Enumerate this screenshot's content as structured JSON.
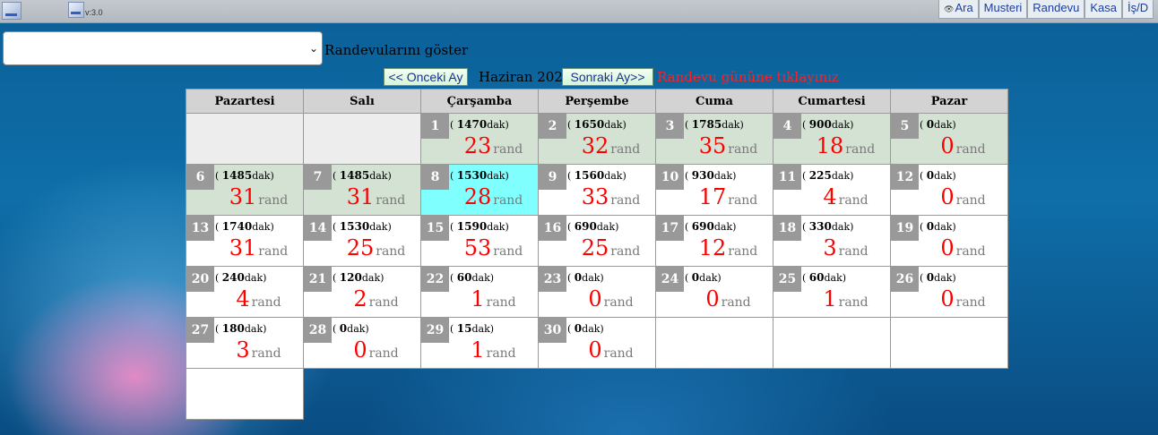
{
  "app": {
    "version": "v:3.0",
    "nav": [
      "Ara",
      "Musteri",
      "Randevu",
      "Kasa",
      "İş/D"
    ]
  },
  "filter": {
    "select_value": "",
    "label": "Randevularını göster"
  },
  "month_nav": {
    "prev_label": "<< Onceki Ay",
    "title": "Haziran 2022",
    "next_label": "Sonraki Ay>>",
    "hint": "Randevu gününe tıklayınız"
  },
  "calendar": {
    "weekdays": [
      "Pazartesi",
      "Salı",
      "Çarşamba",
      "Perşembe",
      "Cuma",
      "Cumartesi",
      "Pazar"
    ],
    "leading_empty": 2,
    "trailing_empty": 4,
    "unit_open": "(",
    "minutes_unit": "dak)",
    "count_unit": "rand",
    "days": [
      {
        "day": "1",
        "minutes": "1470",
        "count": "23",
        "state": "past"
      },
      {
        "day": "2",
        "minutes": "1650",
        "count": "32",
        "state": "past"
      },
      {
        "day": "3",
        "minutes": "1785",
        "count": "35",
        "state": "past"
      },
      {
        "day": "4",
        "minutes": "900",
        "count": "18",
        "state": "past"
      },
      {
        "day": "5",
        "minutes": "0",
        "count": "0",
        "state": "past"
      },
      {
        "day": "6",
        "minutes": "1485",
        "count": "31",
        "state": "past"
      },
      {
        "day": "7",
        "minutes": "1485",
        "count": "31",
        "state": "past"
      },
      {
        "day": "8",
        "minutes": "1530",
        "count": "28",
        "state": "today"
      },
      {
        "day": "9",
        "minutes": "1560",
        "count": "33",
        "state": "future"
      },
      {
        "day": "10",
        "minutes": "930",
        "count": "17",
        "state": "future"
      },
      {
        "day": "11",
        "minutes": "225",
        "count": "4",
        "state": "future"
      },
      {
        "day": "12",
        "minutes": "0",
        "count": "0",
        "state": "future"
      },
      {
        "day": "13",
        "minutes": "1740",
        "count": "31",
        "state": "future"
      },
      {
        "day": "14",
        "minutes": "1530",
        "count": "25",
        "state": "future"
      },
      {
        "day": "15",
        "minutes": "1590",
        "count": "53",
        "state": "future"
      },
      {
        "day": "16",
        "minutes": "690",
        "count": "25",
        "state": "future"
      },
      {
        "day": "17",
        "minutes": "690",
        "count": "12",
        "state": "future"
      },
      {
        "day": "18",
        "minutes": "330",
        "count": "3",
        "state": "future"
      },
      {
        "day": "19",
        "minutes": "0",
        "count": "0",
        "state": "future"
      },
      {
        "day": "20",
        "minutes": "240",
        "count": "4",
        "state": "future"
      },
      {
        "day": "21",
        "minutes": "120",
        "count": "2",
        "state": "future"
      },
      {
        "day": "22",
        "minutes": "60",
        "count": "1",
        "state": "future"
      },
      {
        "day": "23",
        "minutes": "0",
        "count": "0",
        "state": "future"
      },
      {
        "day": "24",
        "minutes": "0",
        "count": "0",
        "state": "future"
      },
      {
        "day": "25",
        "minutes": "60",
        "count": "1",
        "state": "future"
      },
      {
        "day": "26",
        "minutes": "0",
        "count": "0",
        "state": "future"
      },
      {
        "day": "27",
        "minutes": "180",
        "count": "3",
        "state": "future"
      },
      {
        "day": "28",
        "minutes": "0",
        "count": "0",
        "state": "future"
      },
      {
        "day": "29",
        "minutes": "15",
        "count": "1",
        "state": "future"
      },
      {
        "day": "30",
        "minutes": "0",
        "count": "0",
        "state": "future"
      }
    ]
  }
}
